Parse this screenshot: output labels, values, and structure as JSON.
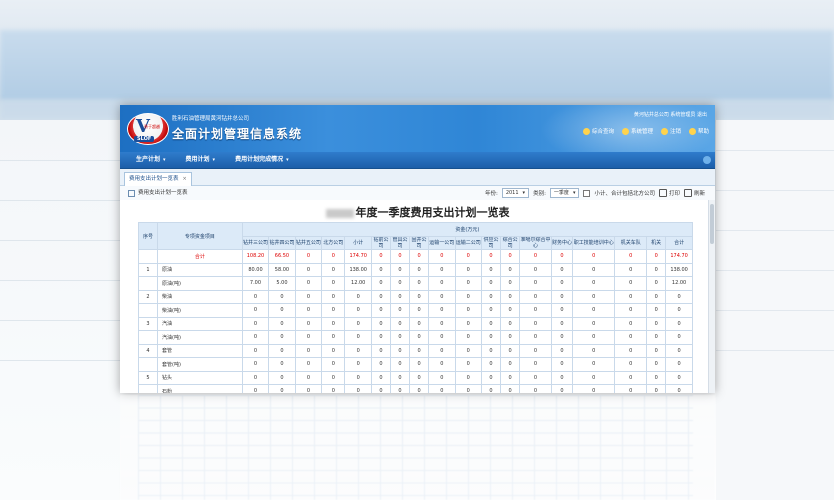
{
  "header": {
    "logo_letter": "V",
    "logo_tag": "勇于超越",
    "logo_sub": "SLOF",
    "company": "胜利石油管理局黄河钻井总公司",
    "system_title": "全面计划管理信息系统",
    "user_info": "黄河钻井总公司  系统管理员  退出",
    "actions": [
      {
        "label": "综合查询",
        "icon": "search-icon"
      },
      {
        "label": "系统管理",
        "icon": "gear-icon"
      },
      {
        "label": "注销",
        "icon": "logout-icon"
      },
      {
        "label": "帮助",
        "icon": "help-icon"
      }
    ]
  },
  "nav": {
    "items": [
      "生产计划",
      "费用计划",
      "费用计划完成情况"
    ]
  },
  "tab": {
    "label": "费用支出计划一览表",
    "close": "×"
  },
  "toolbar": {
    "title": "费用支出计划一览表",
    "year_label": "年份:",
    "year_value": "2011",
    "type_label": "类别:",
    "type_value": "一季度",
    "checkbox_label": "小计、合计包括北方公司",
    "print_label": "打印",
    "refresh_label": "刷新"
  },
  "report": {
    "title": "年度一季度费用支出计划一览表",
    "col_seq": "序号",
    "col_item": "专项资金项目",
    "col_group": "资金(万元)",
    "columns": [
      "钻井三公司",
      "钻井四公司",
      "钻井五公司",
      "北方公司",
      "小计",
      "钻前公司",
      "管具公司",
      "固井公司",
      "运输一公司",
      "运输二公司",
      "供应公司",
      "综合公司",
      "准噶尔综合中心",
      "财务中心",
      "职工技能培训中心",
      "机关车队",
      "机关",
      "合计"
    ],
    "rows": [
      {
        "seq": "",
        "item": "合计",
        "sum": true,
        "values": [
          "108.20",
          "66.50",
          "0",
          "0",
          "174.70",
          "0",
          "0",
          "0",
          "0",
          "0",
          "0",
          "0",
          "0",
          "0",
          "0",
          "0",
          "0",
          "174.70"
        ]
      },
      {
        "seq": "1",
        "item": "原油",
        "values": [
          "80.00",
          "58.00",
          "0",
          "0",
          "138.00",
          "0",
          "0",
          "0",
          "0",
          "0",
          "0",
          "0",
          "0",
          "0",
          "0",
          "0",
          "0",
          "138.00"
        ]
      },
      {
        "seq": "",
        "item": "原油(吨)",
        "values": [
          "7.00",
          "5.00",
          "0",
          "0",
          "12.00",
          "0",
          "0",
          "0",
          "0",
          "0",
          "0",
          "0",
          "0",
          "0",
          "0",
          "0",
          "0",
          "12.00"
        ]
      },
      {
        "seq": "2",
        "item": "柴油",
        "values": [
          "0",
          "0",
          "0",
          "0",
          "0",
          "0",
          "0",
          "0",
          "0",
          "0",
          "0",
          "0",
          "0",
          "0",
          "0",
          "0",
          "0",
          "0"
        ]
      },
      {
        "seq": "",
        "item": "柴油(吨)",
        "values": [
          "0",
          "0",
          "0",
          "0",
          "0",
          "0",
          "0",
          "0",
          "0",
          "0",
          "0",
          "0",
          "0",
          "0",
          "0",
          "0",
          "0",
          "0"
        ]
      },
      {
        "seq": "3",
        "item": "汽油",
        "values": [
          "0",
          "0",
          "0",
          "0",
          "0",
          "0",
          "0",
          "0",
          "0",
          "0",
          "0",
          "0",
          "0",
          "0",
          "0",
          "0",
          "0",
          "0"
        ]
      },
      {
        "seq": "",
        "item": "汽油(吨)",
        "values": [
          "0",
          "0",
          "0",
          "0",
          "0",
          "0",
          "0",
          "0",
          "0",
          "0",
          "0",
          "0",
          "0",
          "0",
          "0",
          "0",
          "0",
          "0"
        ]
      },
      {
        "seq": "4",
        "item": "套管",
        "values": [
          "0",
          "0",
          "0",
          "0",
          "0",
          "0",
          "0",
          "0",
          "0",
          "0",
          "0",
          "0",
          "0",
          "0",
          "0",
          "0",
          "0",
          "0"
        ]
      },
      {
        "seq": "",
        "item": "套管(吨)",
        "values": [
          "0",
          "0",
          "0",
          "0",
          "0",
          "0",
          "0",
          "0",
          "0",
          "0",
          "0",
          "0",
          "0",
          "0",
          "0",
          "0",
          "0",
          "0"
        ]
      },
      {
        "seq": "5",
        "item": "钻头",
        "values": [
          "0",
          "0",
          "0",
          "0",
          "0",
          "0",
          "0",
          "0",
          "0",
          "0",
          "0",
          "0",
          "0",
          "0",
          "0",
          "0",
          "0",
          "0"
        ]
      },
      {
        "seq": "",
        "item": "石粉",
        "values": [
          "0",
          "0",
          "0",
          "0",
          "0",
          "0",
          "0",
          "0",
          "0",
          "0",
          "0",
          "0",
          "0",
          "0",
          "0",
          "0",
          "0",
          "0"
        ]
      }
    ]
  }
}
